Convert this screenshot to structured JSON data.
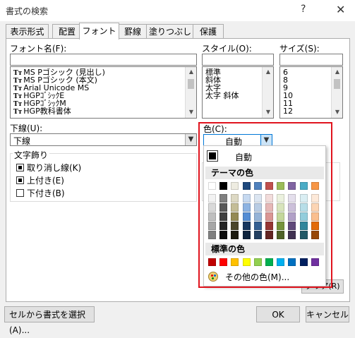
{
  "window": {
    "title": "書式の検索",
    "help": "?",
    "close": "✕"
  },
  "tabs": [
    {
      "label": "表示形式",
      "active": false
    },
    {
      "label": "配置",
      "active": false
    },
    {
      "label": "フォント",
      "active": true
    },
    {
      "label": "罫線",
      "active": false
    },
    {
      "label": "塗りつぶし",
      "active": false
    },
    {
      "label": "保護",
      "active": false
    }
  ],
  "font": {
    "label": "フォント名(F):",
    "value": "",
    "icon": "truetype-icon",
    "items": [
      "MS Pゴシック (見出し)",
      "MS Pゴシック (本文)",
      "Arial Unicode MS",
      "HGPｺﾞｼｯｸE",
      "HGPｺﾞｼｯｸM",
      "HGP教科書体"
    ]
  },
  "style": {
    "label": "スタイル(O):",
    "value": "",
    "items": [
      "標準",
      "斜体",
      "太字",
      "太字 斜体"
    ]
  },
  "size": {
    "label": "サイズ(S):",
    "value": "",
    "items": [
      "6",
      "8",
      "9",
      "10",
      "11",
      "12"
    ]
  },
  "underline": {
    "label": "下線(U):",
    "value": "下線"
  },
  "color": {
    "label": "色(C):",
    "value": "自動"
  },
  "effects": {
    "label": "文字飾り",
    "items": [
      {
        "label": "取り消し線(K)",
        "state": "indeterminate"
      },
      {
        "label": "上付き(E)",
        "state": "indeterminate"
      },
      {
        "label": "下付き(B)",
        "state": "unchecked"
      }
    ]
  },
  "popup": {
    "auto_label": "自動",
    "theme_label": "テーマの色",
    "standard_label": "標準の色",
    "more_label": "その他の色(M)...",
    "theme_colors": [
      [
        "#ffffff",
        "#f2f2f2",
        "#d9d9d9",
        "#bfbfbf",
        "#a6a6a6",
        "#808080"
      ],
      [
        "#000000",
        "#808080",
        "#595959",
        "#404040",
        "#262626",
        "#0d0d0d"
      ],
      [
        "#eeece1",
        "#ddd9c4",
        "#c4bd97",
        "#948a54",
        "#4a452a",
        "#1d1b10"
      ],
      [
        "#1f497d",
        "#c6d9f0",
        "#8db3e2",
        "#548dd4",
        "#17365d",
        "#0f243e"
      ],
      [
        "#4f81bd",
        "#dbe5f1",
        "#b8cce4",
        "#95b3d7",
        "#366092",
        "#244061"
      ],
      [
        "#c0504d",
        "#f2dcdb",
        "#e6b8b7",
        "#da9694",
        "#963634",
        "#632523"
      ],
      [
        "#9bbb59",
        "#ebf1de",
        "#d8e4bc",
        "#c4d79b",
        "#76933c",
        "#4f6228"
      ],
      [
        "#8064a2",
        "#e4dfec",
        "#ccc0da",
        "#b1a0c7",
        "#60497a",
        "#403151"
      ],
      [
        "#4bacc6",
        "#daeef3",
        "#b7dee8",
        "#92cddc",
        "#31869b",
        "#215967"
      ],
      [
        "#f79646",
        "#fde9d9",
        "#fcd5b4",
        "#fabf8f",
        "#e26b0a",
        "#974706"
      ]
    ],
    "standard_colors": [
      "#c00000",
      "#ff0000",
      "#ffc000",
      "#ffff00",
      "#92d050",
      "#00b050",
      "#00b0f0",
      "#0070c0",
      "#002060",
      "#7030a0"
    ]
  },
  "buttons": {
    "pick_from_cell": "セルから書式を選択(A)...",
    "clear": "クリア(R)",
    "ok": "OK",
    "cancel": "キャンセル"
  }
}
